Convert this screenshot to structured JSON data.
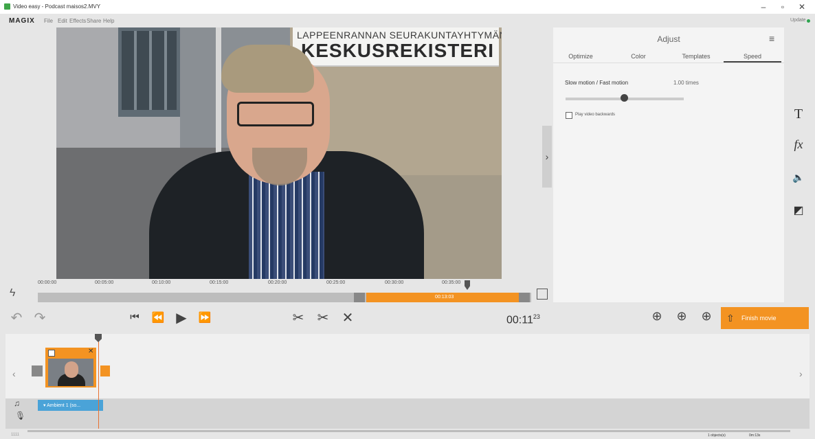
{
  "window": {
    "title": "Video easy - Podcast maisos2.MVY",
    "minimize": "–",
    "maximize": "▫",
    "close": "✕"
  },
  "menubar": {
    "brand": "MAGIX",
    "items": [
      "File",
      "Edit",
      "Effects",
      "Share",
      "Help"
    ],
    "update": "Update"
  },
  "preview": {
    "sign_line1": "LAPPEENRANNAN SEURAKUNTAYHTYMÄN",
    "sign_line2": "KESKUSREKISTERI",
    "ruler_ticks": [
      "00:00:00",
      "00:05:00",
      "00:10:00",
      "00:15:00",
      "00:20:00",
      "00:25:00",
      "00:30:00",
      "00:35:00"
    ],
    "range_time": "00:13:03"
  },
  "adjust_panel": {
    "title": "Adjust",
    "tabs": [
      "Optimize",
      "Color",
      "Templates",
      "Speed"
    ],
    "active_tab": "Speed",
    "speed_label": "Slow motion / Fast motion",
    "speed_value": "1.00 times",
    "reverse_label": "Play video backwards"
  },
  "side_icons": {
    "text": "T",
    "effects": "fx",
    "audio": "🔈",
    "overlay": "◩"
  },
  "transport": {
    "undo": "↶",
    "redo": "↷",
    "to_start": "⏮",
    "rewind": "⏪",
    "play": "▶",
    "forward": "⏩",
    "cut_split": "✂",
    "cut_remove": "✂",
    "delete": "✕",
    "timecode_main": "00:11",
    "timecode_frames": "23",
    "finish_label": "Finish movie"
  },
  "timeline": {
    "audio_clip_label": "▾ Ambient 1 (so..."
  },
  "status": {
    "left": "1111",
    "objects": "1 objects(s)",
    "duration": "0m:13s"
  },
  "colors": {
    "accent": "#f39322",
    "audio_clip": "#4aa3d8"
  }
}
